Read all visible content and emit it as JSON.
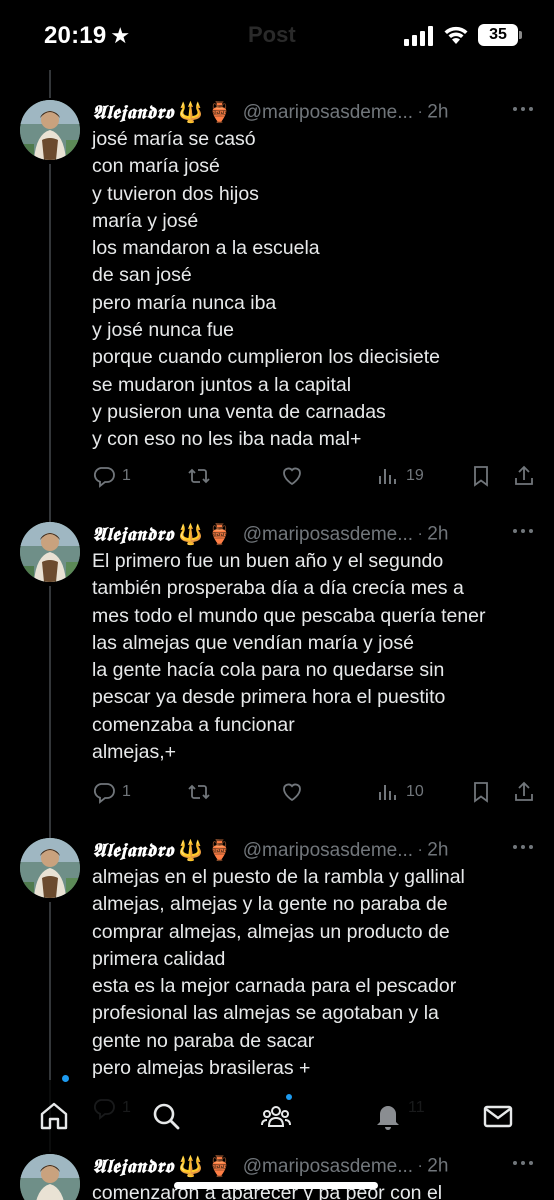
{
  "status": {
    "time": "20:19",
    "ghost_title": "Post",
    "battery": "35"
  },
  "author": {
    "name": "𝕬𝖑𝖊𝖏𝖆𝖓𝖉𝖗𝖔",
    "emoji_trident": "🔱",
    "emoji_vase": "🏺",
    "handle": "@mariposasdeme...",
    "separator": "·"
  },
  "tweets": [
    {
      "time": "2h",
      "text": "josé maría se casó\ncon maría josé\ny tuvieron dos hijos\nmaría y josé\nlos mandaron a la escuela\nde san josé\npero maría nunca iba\ny josé nunca fue\nporque cuando cumplieron los diecisiete\nse mudaron juntos a la capital\ny pusieron una venta de carnadas\ny con eso no les iba nada mal+",
      "replies": "1",
      "views": "19"
    },
    {
      "time": "2h",
      "text": "El primero fue un buen año y el segundo\ntambién prosperaba día a día crecía mes a\nmes todo el mundo que pescaba quería tener\nlas almejas que vendían maría y josé\nla gente hacía cola para no quedarse sin\npescar ya desde primera hora el puestito\ncomenzaba a funcionar\nalmejas,+",
      "replies": "1",
      "views": "10"
    },
    {
      "time": "2h",
      "text": "almejas en el puesto de la rambla y gallinal\nalmejas, almejas y la gente no paraba de\ncomprar almejas, almejas un producto de\nprimera calidad\nesta es la mejor carnada para el pescador\nprofesional las almejas se agotaban y la\ngente no paraba de sacar\npero almejas brasileras +",
      "replies": "1",
      "views": "11"
    },
    {
      "time": "2h",
      "text": "comenzaron a aparecer y pa peor con el",
      "replies": "",
      "views": ""
    }
  ],
  "colors": {
    "background": "#000000",
    "text": "#e7e9ea",
    "muted": "#71767b",
    "accent": "#1d9bf0"
  },
  "icons": {
    "reply": "reply-icon",
    "retweet": "retweet-icon",
    "like": "like-icon",
    "views": "views-icon",
    "bookmark": "bookmark-icon",
    "share": "share-icon",
    "nav": [
      "home-icon",
      "search-icon",
      "communities-icon",
      "notifications-icon",
      "messages-icon"
    ]
  }
}
